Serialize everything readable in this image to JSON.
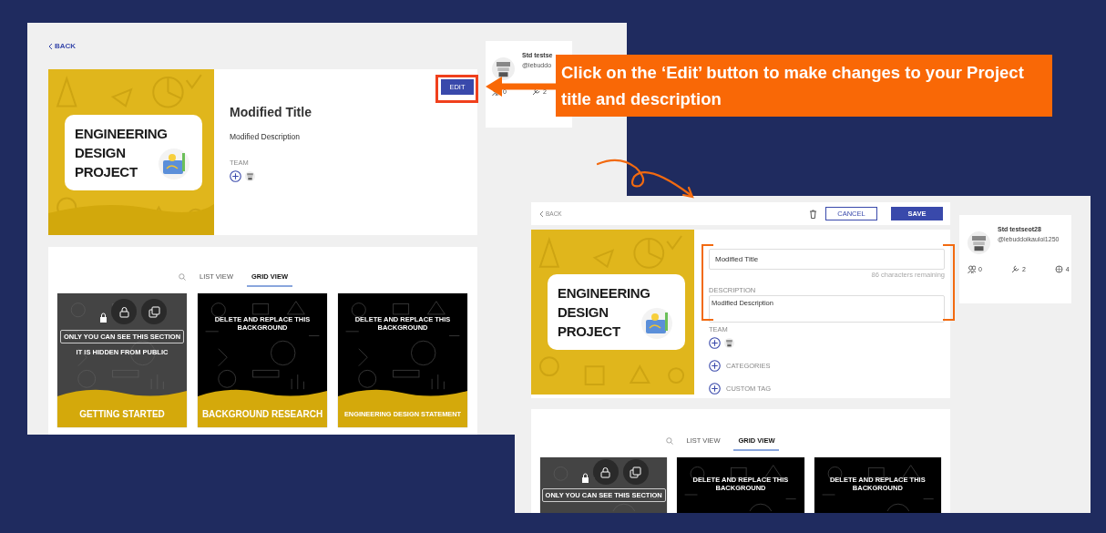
{
  "callout": {
    "text": "Click on the ‘Edit’ button to make changes to your Project title and description"
  },
  "view_screen": {
    "back": "BACK",
    "project": {
      "cover_lines": [
        "ENGINEERING",
        "DESIGN",
        "PROJECT"
      ],
      "title": "Modified Title",
      "description": "Modified Description",
      "team_label": "TEAM",
      "edit_button": "EDIT"
    },
    "profile": {
      "name": "Std testse",
      "handle": "@lebuddo",
      "stats": [
        {
          "kind": "members",
          "value": "0"
        },
        {
          "kind": "tools",
          "value": "2"
        }
      ]
    },
    "tabs": [
      {
        "label": "LIST VIEW",
        "selected": false
      },
      {
        "label": "GRID VIEW",
        "selected": true
      }
    ],
    "cards": [
      {
        "kind": "private",
        "badge": "ONLY YOU CAN SEE THIS SECTION",
        "note": "IT IS HIDDEN FROM PUBLIC",
        "title": "GETTING STARTED"
      },
      {
        "kind": "template",
        "banner": "DELETE AND REPLACE THIS BACKGROUND",
        "title": "BACKGROUND RESEARCH"
      },
      {
        "kind": "template",
        "banner": "DELETE AND REPLACE THIS BACKGROUND",
        "title": "ENGINEERING DESIGN STATEMENT"
      }
    ]
  },
  "edit_screen": {
    "back": "BACK",
    "cancel_button": "CANCEL",
    "save_button": "SAVE",
    "cover_lines": [
      "ENGINEERING",
      "DESIGN",
      "PROJECT"
    ],
    "title_field": {
      "value": "Modified Title"
    },
    "counter": "86 characters remaining",
    "description_label": "DESCRIPTION",
    "description_field": {
      "value": "Modified Description"
    },
    "team_label": "TEAM",
    "add_items": [
      "CATEGORIES",
      "CUSTOM TAG"
    ],
    "profile": {
      "name": "Std testseot28",
      "handle": "@lebuddoikauloi1250",
      "stats": [
        {
          "kind": "members",
          "value": "0"
        },
        {
          "kind": "tools",
          "value": "2"
        },
        {
          "kind": "skills",
          "value": "4"
        }
      ]
    },
    "tabs": [
      {
        "label": "LIST VIEW",
        "selected": false
      },
      {
        "label": "GRID VIEW",
        "selected": true
      }
    ],
    "cards": [
      {
        "kind": "private",
        "badge": "ONLY YOU CAN SEE THIS SECTION"
      },
      {
        "kind": "template",
        "banner": "DELETE AND REPLACE THIS BACKGROUND"
      },
      {
        "kind": "template",
        "banner": "DELETE AND REPLACE THIS BACKGROUND"
      }
    ]
  }
}
